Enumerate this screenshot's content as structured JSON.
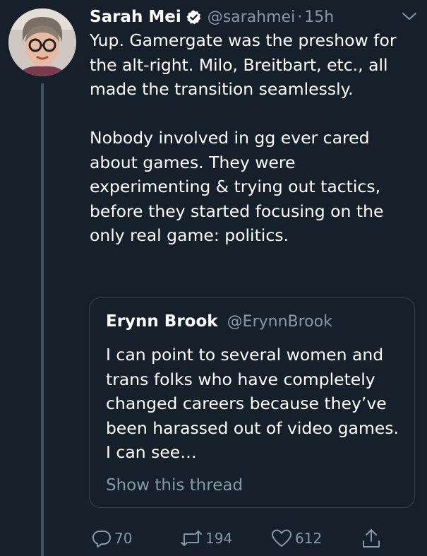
{
  "author": {
    "name": "Sarah Mei",
    "handle": "@sarahmei",
    "separator": "·",
    "time": "15h",
    "verified": true
  },
  "tweet": {
    "paragraphs": [
      "Yup. Gamergate was the preshow for the alt-right. Milo, Breitbart, etc., all made the transition seamlessly.",
      "Nobody involved in gg ever cared about games. They were experimenting & trying out tactics, before they started focusing on the only real game: politics."
    ]
  },
  "quoted_tweet": {
    "name": "Erynn Brook",
    "handle": "@ErynnBrook",
    "text": "I can point to several women and trans folks who have completely changed careers because they’ve been harassed out of video games. I can see…",
    "show_thread_label": "Show this thread"
  },
  "actions": {
    "reply_count": "70",
    "retweet_count": "194",
    "like_count": "612"
  },
  "icons": {
    "verified": "verified-badge-icon",
    "caret": "chevron-down-icon",
    "reply": "reply-icon",
    "retweet": "retweet-icon",
    "like": "heart-icon",
    "share": "share-icon"
  },
  "colors": {
    "background": "#15202b",
    "text": "#ffffff",
    "muted": "#8899a6",
    "border": "#38444d"
  }
}
